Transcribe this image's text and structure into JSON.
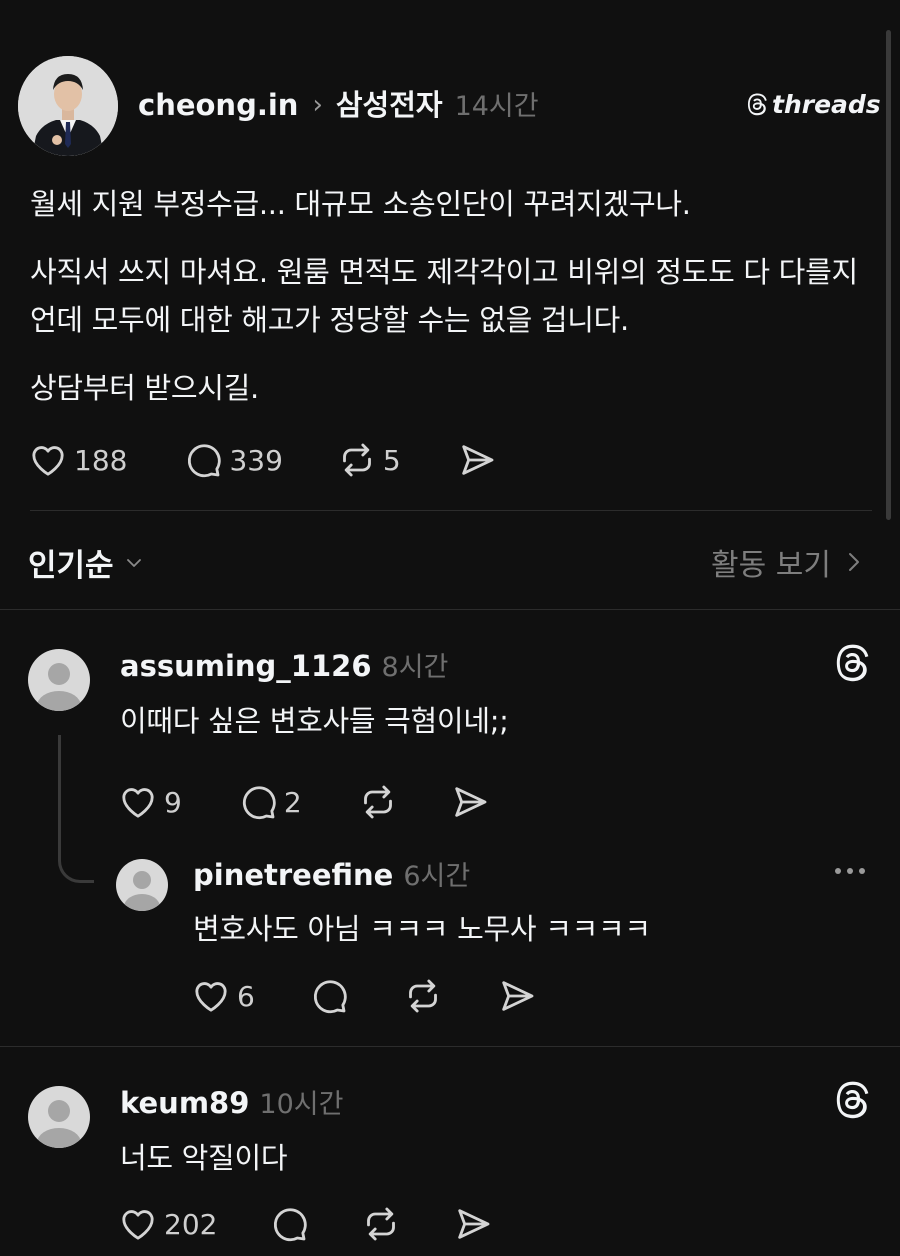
{
  "post": {
    "author": "cheong.in",
    "separator": "›",
    "community": "삼성전자",
    "time": "14시간",
    "brand": "threads",
    "paragraphs": [
      "월세 지원 부정수급... 대규모 소송인단이 꾸려지겠구나.",
      "사직서 쓰지 마셔요. 원룸 면적도 제각각이고 비위의 정도도 다 다를지언데 모두에 대한 해고가 정당할 수는 없을 겁니다.",
      "상담부터 받으시길."
    ],
    "likes": "188",
    "replies": "339",
    "reposts": "5"
  },
  "sort": {
    "label": "인기순",
    "activity": "활동 보기"
  },
  "comments": [
    {
      "user": "assuming_1126",
      "time": "8시간",
      "text": "이때다 싶은 변호사들 극혐이네;;",
      "likes": "9",
      "replies": "2",
      "reply": {
        "user": "pinetreefine",
        "time": "6시간",
        "text": "변호사도 아님 ㅋㅋㅋ 노무사 ㅋㅋㅋㅋ",
        "likes": "6"
      }
    },
    {
      "user": "keum89",
      "time": "10시간",
      "text": "너도 악질이다",
      "likes": "202"
    }
  ],
  "icons": {
    "like": "heart-icon",
    "reply": "comment-icon",
    "repost": "repost-icon",
    "share": "send-icon",
    "brand": "threads-logo-icon",
    "more": "more-icon"
  },
  "colors": {
    "background": "#101010",
    "text": "#f3f5f7",
    "secondary": "#6f6f6f",
    "divider": "#2c2c2c"
  }
}
